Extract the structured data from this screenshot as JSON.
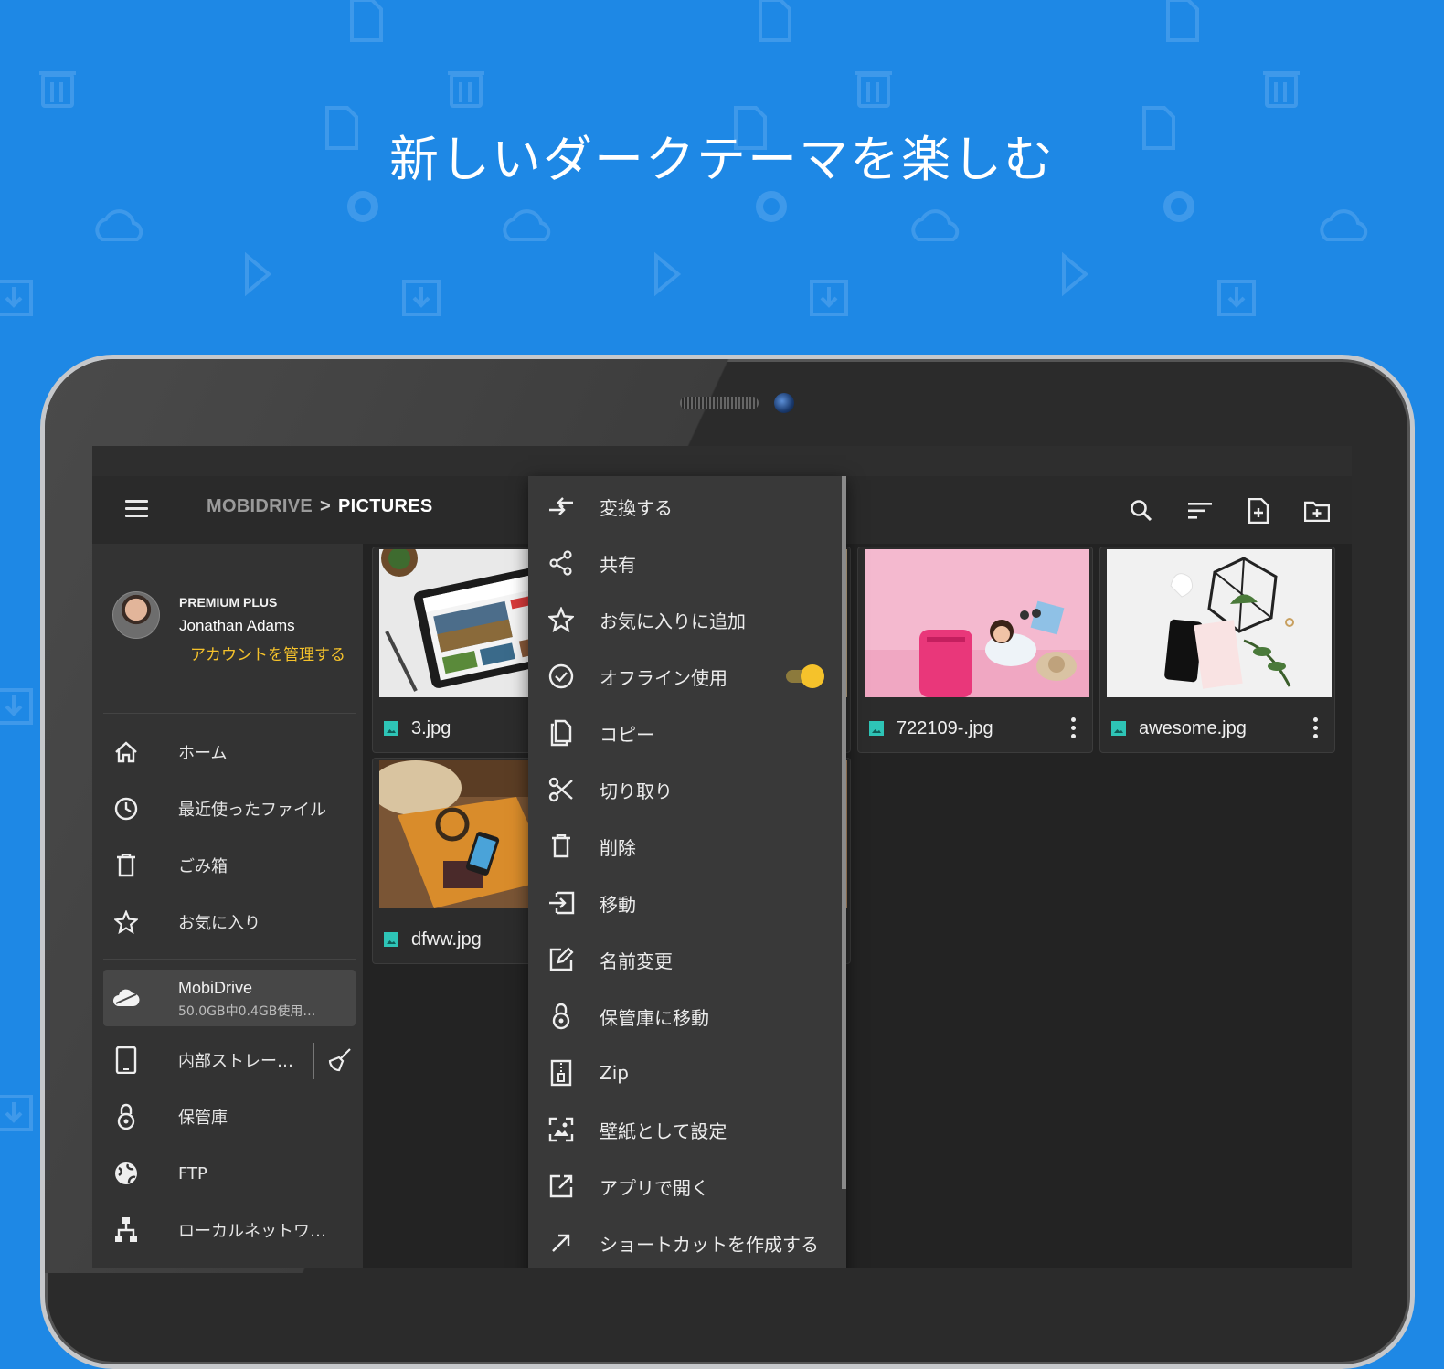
{
  "headline": "新しいダークテーマを楽しむ",
  "colors": {
    "background": "#1e88e5",
    "accent": "#f5c22b",
    "dark": "#222222"
  },
  "appbar": {
    "breadcrumb_root": "MOBIDRIVE",
    "breadcrumb_separator": ">",
    "breadcrumb_current": "PICTURES",
    "icons": [
      "menu-icon",
      "search-icon",
      "sort-icon",
      "new-file-icon",
      "new-folder-icon"
    ]
  },
  "drawer": {
    "plan": "PREMIUM PLUS",
    "user_name": "Jonathan Adams",
    "manage_account": "アカウントを管理する",
    "items": [
      {
        "label": "ホーム",
        "icon": "home-icon"
      },
      {
        "label": "最近使ったファイル",
        "icon": "clock-icon"
      },
      {
        "label": "ごみ箱",
        "icon": "trash-icon"
      },
      {
        "label": "お気に入り",
        "icon": "star-icon"
      }
    ],
    "storage": {
      "cloud_label": "MobiDrive",
      "cloud_usage": "50.0GB中0.4GB使用…",
      "internal_label": "内部ストレー…",
      "vault_label": "保管庫",
      "ftp_label": "FTP",
      "network_label": "ローカルネットワ…"
    }
  },
  "files": [
    {
      "name": "3.jpg"
    },
    {
      "name": "722109-.jpg"
    },
    {
      "name": "awesome.jpg"
    },
    {
      "name": "dfww.jpg"
    }
  ],
  "context_menu": {
    "items": [
      {
        "label": "変換する",
        "icon": "convert-icon"
      },
      {
        "label": "共有",
        "icon": "share-icon"
      },
      {
        "label": "お気に入りに追加",
        "icon": "star-outline-icon"
      },
      {
        "label": "オフライン使用",
        "icon": "offline-check-icon",
        "toggle_on": true
      },
      {
        "label": "コピー",
        "icon": "copy-icon"
      },
      {
        "label": "切り取り",
        "icon": "scissors-icon"
      },
      {
        "label": "削除",
        "icon": "trash-icon"
      },
      {
        "label": "移動",
        "icon": "move-icon"
      },
      {
        "label": "名前変更",
        "icon": "rename-icon"
      },
      {
        "label": "保管庫に移動",
        "icon": "vault-icon"
      },
      {
        "label": "Zip",
        "icon": "zip-icon"
      },
      {
        "label": "壁紙として設定",
        "icon": "wallpaper-icon"
      },
      {
        "label": "アプリで開く",
        "icon": "open-external-icon"
      },
      {
        "label": "ショートカットを作成する",
        "icon": "shortcut-icon"
      }
    ]
  }
}
